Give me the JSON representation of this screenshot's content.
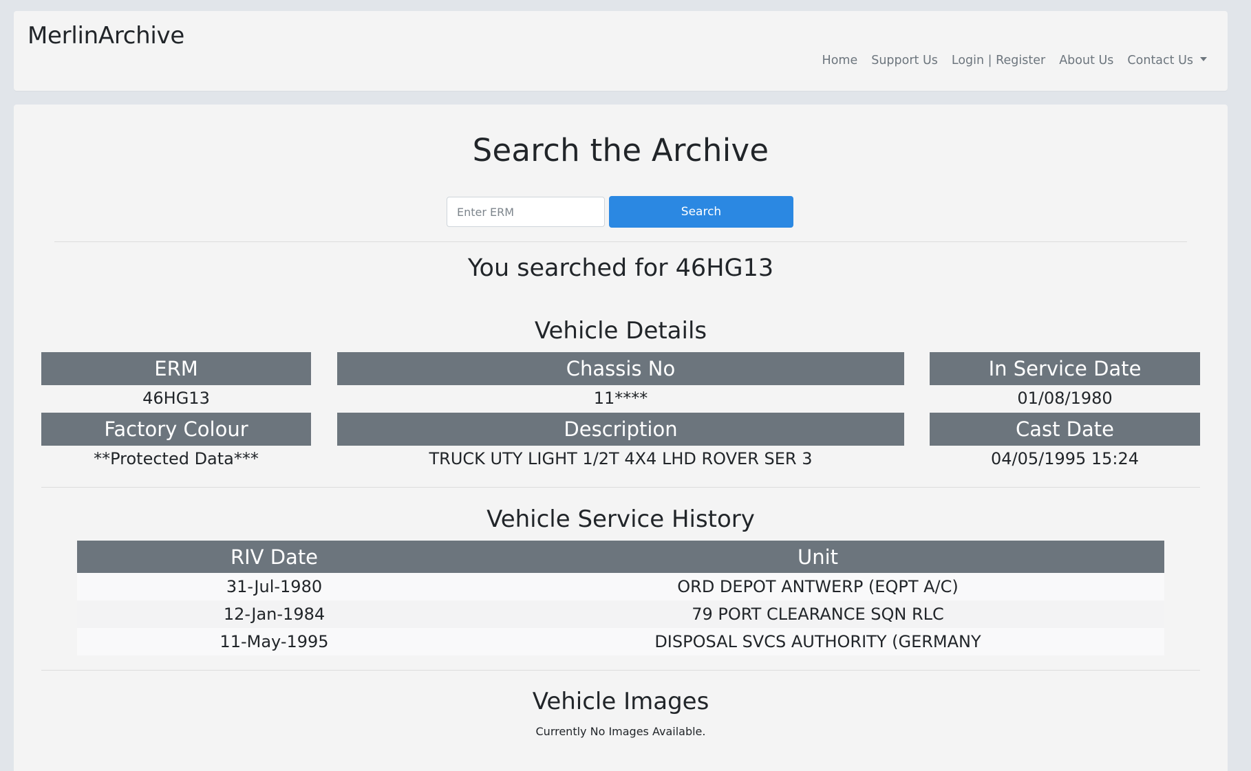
{
  "header": {
    "brand": "MerlinArchive",
    "nav": {
      "home": "Home",
      "support": "Support Us",
      "login": "Login | Register",
      "about": "About Us",
      "contact": "Contact Us"
    }
  },
  "search": {
    "title": "Search the Archive",
    "placeholder": "Enter ERM",
    "value": "",
    "button": "Search",
    "result_text": "You searched for 46HG13"
  },
  "colors": {
    "primary_button": "#2b88e2",
    "header_cell": "#6c757d",
    "page_background": "#e1e5ea",
    "card_background": "#f4f4f4"
  },
  "vehicle_details": {
    "title": "Vehicle Details",
    "erm": {
      "label": "ERM",
      "value": "46HG13"
    },
    "chassis": {
      "label": "Chassis No",
      "value": "11****"
    },
    "in_service": {
      "label": "In Service Date",
      "value": "01/08/1980"
    },
    "factory_colour": {
      "label": "Factory Colour",
      "value": "**Protected Data***"
    },
    "description": {
      "label": "Description",
      "value": "TRUCK UTY LIGHT 1/2T 4X4 LHD ROVER SER 3"
    },
    "cast_date": {
      "label": "Cast Date",
      "value": "04/05/1995 15:24"
    }
  },
  "service_history": {
    "title": "Vehicle Service History",
    "columns": [
      "RIV Date",
      "Unit"
    ],
    "rows": [
      [
        "31-Jul-1980",
        "ORD DEPOT ANTWERP (EQPT A/C)"
      ],
      [
        "12-Jan-1984",
        "79 PORT CLEARANCE SQN RLC"
      ],
      [
        "11-May-1995",
        "DISPOSAL SVCS AUTHORITY (GERMANY"
      ]
    ]
  },
  "images": {
    "title": "Vehicle Images",
    "empty_text": "Currently No Images Available."
  }
}
